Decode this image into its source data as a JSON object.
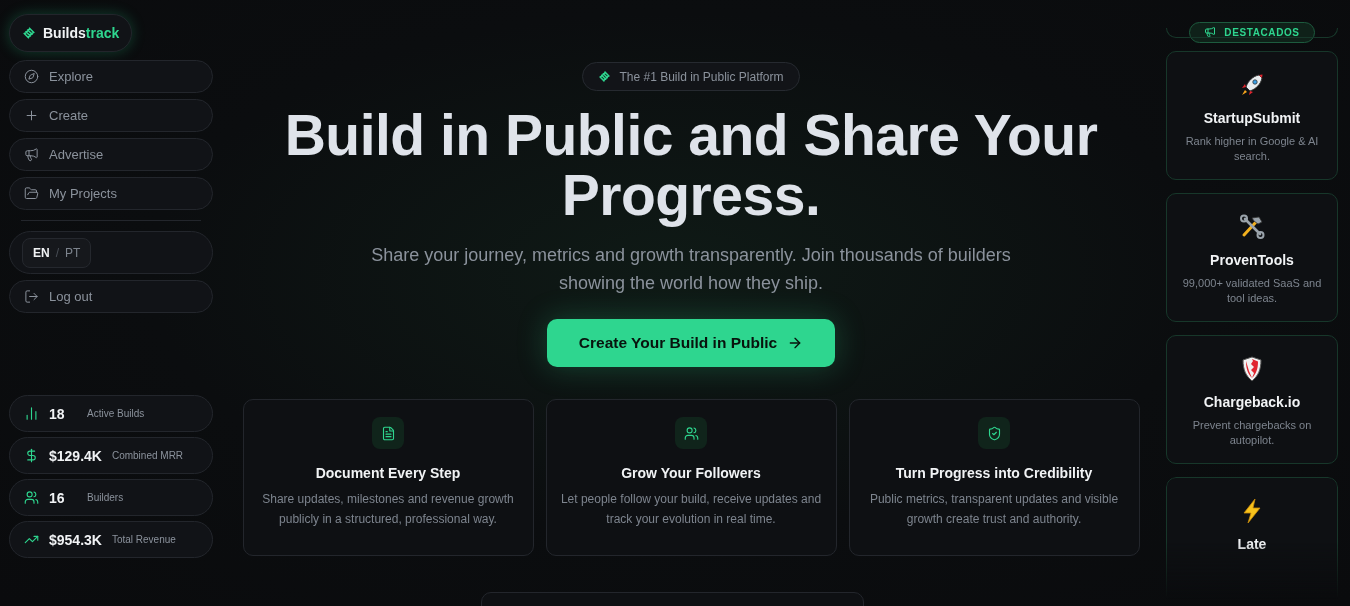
{
  "brand": {
    "name_start": "Builds",
    "name_end": "track"
  },
  "nav": [
    {
      "kind": "explore",
      "label": "Explore"
    },
    {
      "kind": "create",
      "label": "Create"
    },
    {
      "kind": "advertise",
      "label": "Advertise"
    },
    {
      "kind": "projects",
      "label": "My Projects"
    }
  ],
  "languages": {
    "options": [
      {
        "label": "EN",
        "selected": true
      },
      {
        "label": "PT",
        "selected": false
      }
    ],
    "separator": "/"
  },
  "logout": {
    "label": "Log out"
  },
  "stats": [
    {
      "kind": "builds",
      "value": "18",
      "label": "Active Builds"
    },
    {
      "kind": "mrr",
      "value": "$129.4K",
      "label": "Combined MRR"
    },
    {
      "kind": "builders",
      "value": "16",
      "label": "Builders"
    },
    {
      "kind": "revenue",
      "value": "$954.3K",
      "label": "Total Revenue"
    }
  ],
  "hero": {
    "badge": "The #1 Build in Public Platform",
    "title": "Build in Public and Share Your Progress.",
    "subtitle": "Share your journey, metrics and growth transparently. Join thousands of builders showing the world how they ship.",
    "cta": "Create Your Build in Public"
  },
  "features": [
    {
      "kind": "document",
      "title": "Document Every Step",
      "text": "Share updates, milestones and revenue growth publicly in a structured, professional way."
    },
    {
      "kind": "followers",
      "title": "Grow Your Followers",
      "text": "Let people follow your build, receive updates and track your evolution in real time."
    },
    {
      "kind": "credibility",
      "title": "Turn Progress into Credibility",
      "text": "Public metrics, transparent updates and visible growth create trust and authority."
    }
  ],
  "featured": {
    "label": "DESTACADOS",
    "items": [
      {
        "kind": "rocket",
        "title": "StartupSubmit",
        "text": "Rank higher in Google & AI search."
      },
      {
        "kind": "tools",
        "title": "ProvenTools",
        "text": "99,000+ validated SaaS and tool ideas."
      },
      {
        "kind": "shield",
        "title": "Chargeback.io",
        "text": "Prevent chargebacks on autopilot."
      },
      {
        "kind": "bolt",
        "title": "Late"
      }
    ]
  }
}
